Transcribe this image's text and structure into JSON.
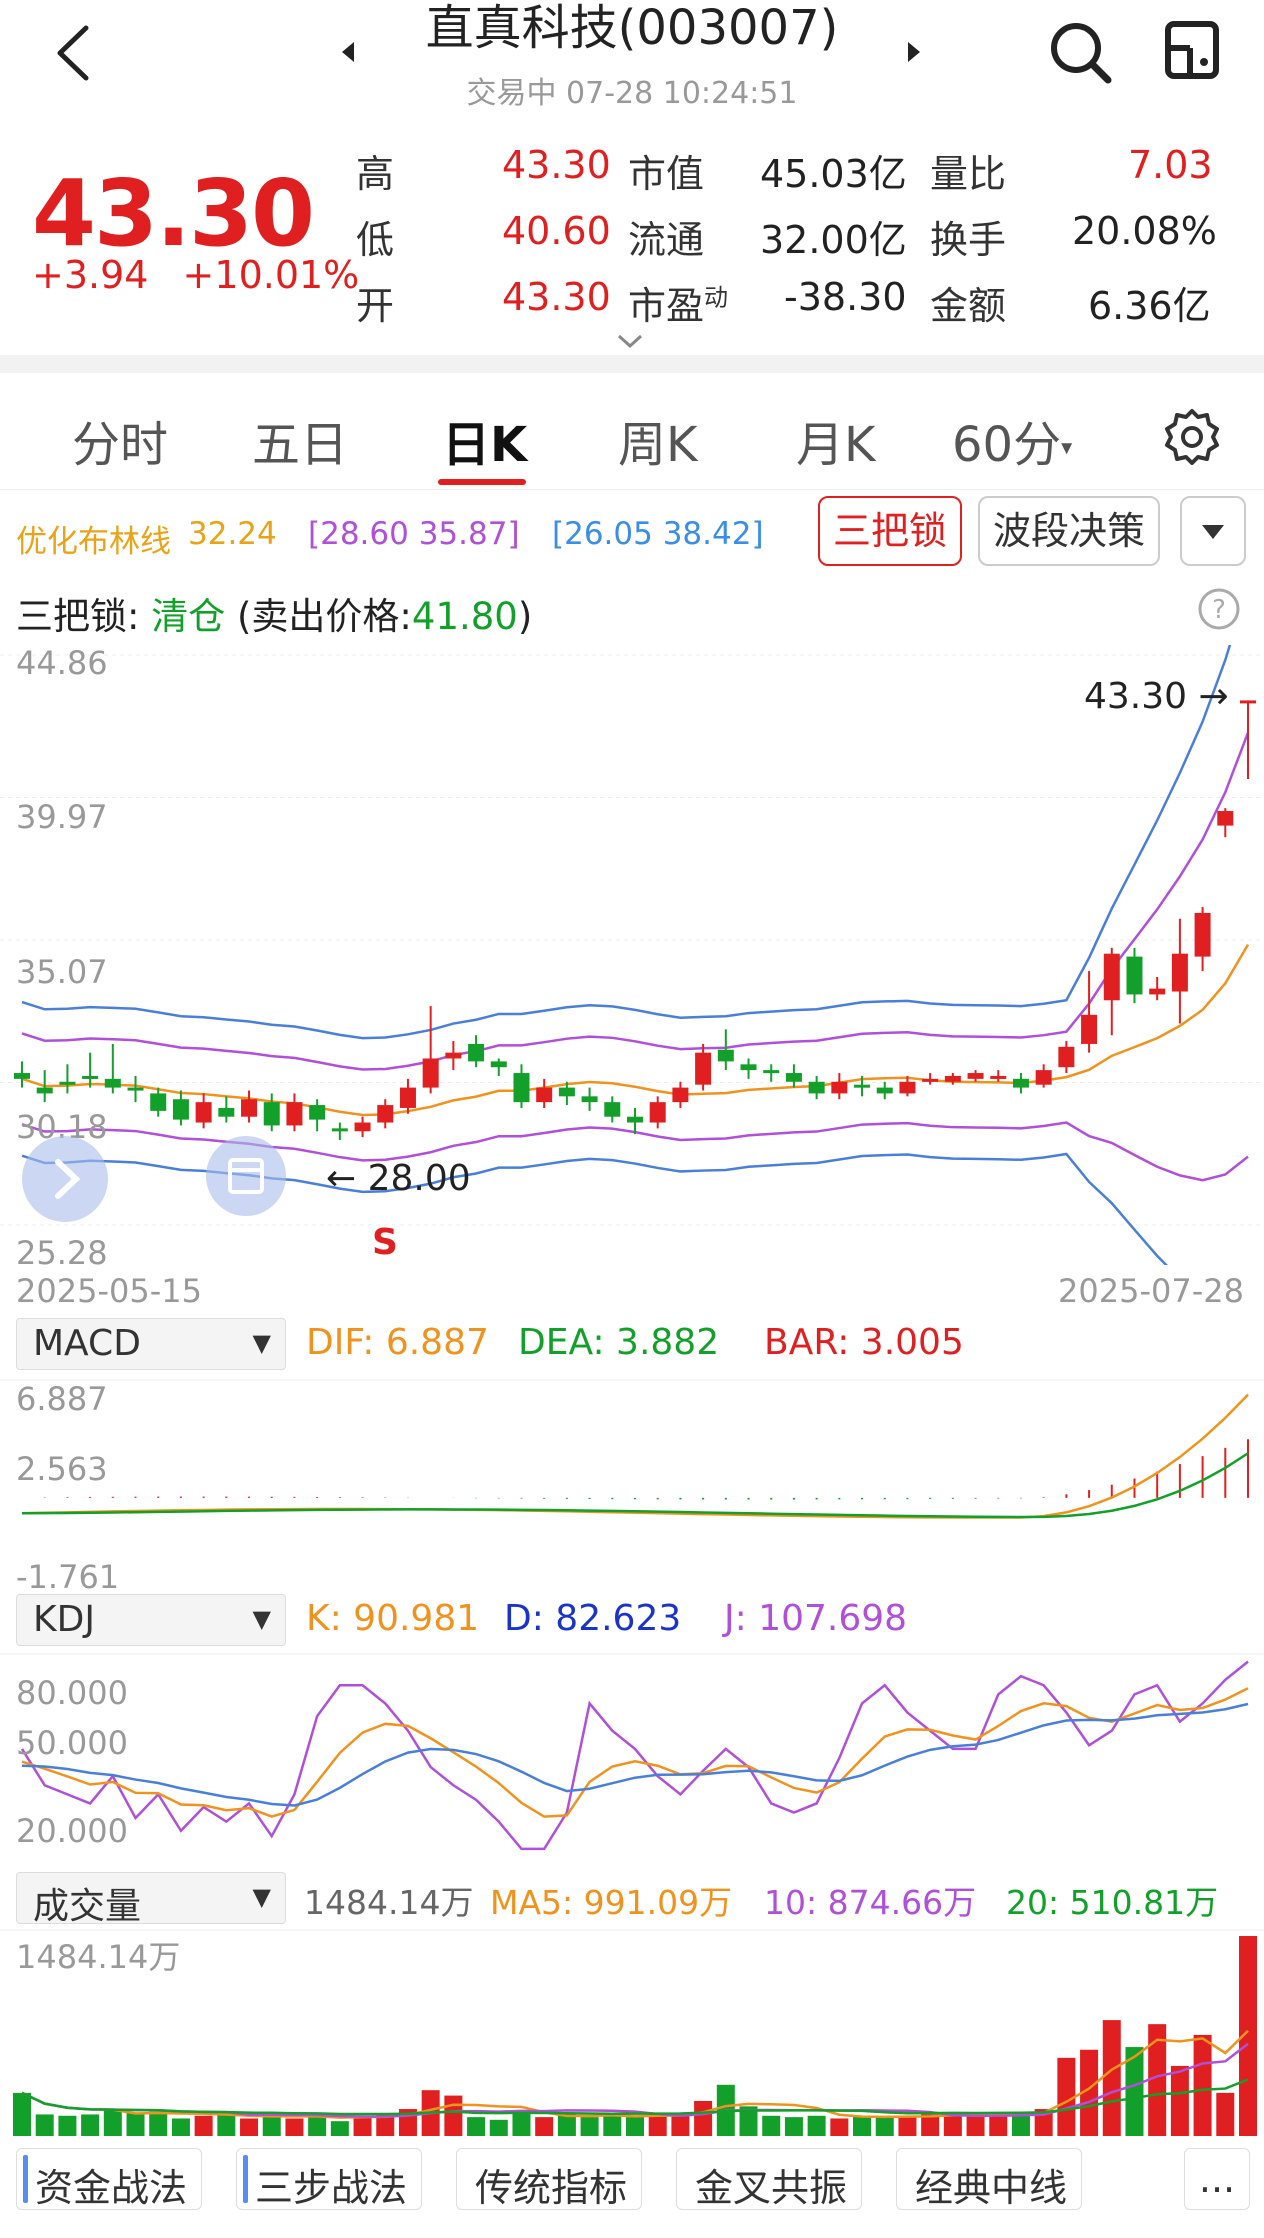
{
  "header": {
    "title": "直真科技(003007)",
    "status": "交易中 07-28 10:24:51",
    "back_icon": "back-icon",
    "prev_icon": "triangle-left-icon",
    "next_icon": "triangle-right-icon"
  },
  "quote": {
    "price": "43.30",
    "change": "+3.94",
    "change_pct": "+10.01%",
    "rows": [
      {
        "l1": "高",
        "v1": "43.30",
        "l2": "市值",
        "v2": "45.03亿",
        "l3": "量比",
        "v3": "7.03"
      },
      {
        "l1": "低",
        "v1": "40.60",
        "l2": "流通",
        "v2": "32.00亿",
        "l3": "换手",
        "v3": "20.08%"
      },
      {
        "l1": "开",
        "v1": "43.30",
        "l2": "市盈",
        "l2sup": "动",
        "v2": "-38.30",
        "l3": "金额",
        "v3": "6.36亿"
      }
    ]
  },
  "tabs": [
    {
      "label": "分时"
    },
    {
      "label": "五日"
    },
    {
      "label": "日K",
      "active": true
    },
    {
      "label": "周K"
    },
    {
      "label": "月K"
    },
    {
      "label": "60分"
    }
  ],
  "boll": {
    "name": "优化布林线",
    "mid": "32.24",
    "band1": "[28.60  35.87]",
    "band2": "[26.05  38.42]",
    "btn_sanbasuo": "三把锁",
    "btn_boduan": "波段决策"
  },
  "lock_status": {
    "label": "三把锁: ",
    "state": "清仓",
    "detail_open": " (卖出价格:",
    "price": "41.80",
    "detail_close": ")"
  },
  "kline_axis": {
    "y_labels": [
      "44.86",
      "39.97",
      "35.07",
      "30.18",
      "25.28"
    ],
    "x_start": "2025-05-15",
    "x_end": "2025-07-28",
    "last_price_tag": "43.30 →",
    "low_price_tag": "← 28.00",
    "s_marker": "S"
  },
  "macd": {
    "selector": "MACD",
    "dif": "DIF: 6.887",
    "dea": "DEA: 3.882",
    "bar": "BAR: 3.005",
    "y_labels": [
      "6.887",
      "2.563",
      "-1.761"
    ]
  },
  "kdj": {
    "selector": "KDJ",
    "k": "K: 90.981",
    "d": "D: 82.623",
    "j": "J: 107.698",
    "y_labels": [
      "80.000",
      "50.000",
      "20.000"
    ]
  },
  "volume": {
    "selector": "成交量",
    "total": "1484.14万",
    "ma5": "MA5: 991.09万",
    "ma10": "10: 874.66万",
    "ma20": "20: 510.81万",
    "y_label": "1484.14万"
  },
  "bottom_tabs": [
    "资金战法",
    "三步战法",
    "传统指标",
    "金叉共振",
    "经典中线",
    "..."
  ],
  "colors": {
    "up": "#e02020",
    "down": "#13a02a",
    "ma_orange": "#f0921e",
    "ma_purple": "#b04fd8",
    "ma_blue": "#4a7fd8"
  },
  "chart_data": {
    "type": "candlestick",
    "x_start": "2025-05-15",
    "x_end": "2025-07-28",
    "ylim": [
      25.28,
      44.86
    ],
    "candles": [
      [
        30.5,
        30.3,
        30.9,
        30.0
      ],
      [
        30.0,
        29.8,
        30.6,
        29.5
      ],
      [
        30.2,
        30.1,
        30.8,
        29.8
      ],
      [
        30.4,
        30.3,
        31.2,
        30.0
      ],
      [
        30.3,
        30.0,
        31.5,
        29.8
      ],
      [
        30.0,
        29.9,
        30.4,
        29.5
      ],
      [
        29.8,
        29.2,
        30.0,
        29.0
      ],
      [
        29.6,
        28.9,
        29.9,
        28.7
      ],
      [
        28.8,
        29.5,
        29.8,
        28.6
      ],
      [
        29.3,
        29.0,
        29.7,
        28.8
      ],
      [
        29.0,
        29.6,
        29.9,
        28.8
      ],
      [
        29.5,
        28.7,
        29.8,
        28.5
      ],
      [
        28.7,
        29.5,
        29.8,
        28.5
      ],
      [
        29.4,
        28.9,
        29.6,
        28.5
      ],
      [
        28.6,
        28.5,
        28.8,
        28.2
      ],
      [
        28.5,
        28.8,
        29.0,
        28.3
      ],
      [
        28.8,
        29.4,
        29.6,
        28.6
      ],
      [
        29.3,
        30.0,
        30.3,
        29.1
      ],
      [
        30.0,
        31.0,
        32.8,
        29.8
      ],
      [
        31.0,
        31.2,
        31.6,
        30.6
      ],
      [
        31.5,
        30.9,
        31.8,
        30.7
      ],
      [
        30.9,
        30.7,
        31.0,
        30.4
      ],
      [
        30.5,
        29.5,
        30.8,
        29.3
      ],
      [
        29.5,
        30.0,
        30.3,
        29.3
      ],
      [
        30.0,
        29.7,
        30.2,
        29.4
      ],
      [
        29.7,
        29.5,
        30.0,
        29.2
      ],
      [
        29.5,
        29.0,
        29.7,
        28.8
      ],
      [
        29.0,
        28.8,
        29.3,
        28.4
      ],
      [
        28.8,
        29.5,
        29.7,
        28.6
      ],
      [
        29.5,
        30.0,
        30.2,
        29.3
      ],
      [
        30.1,
        31.2,
        31.5,
        29.9
      ],
      [
        31.3,
        30.9,
        32.0,
        30.6
      ],
      [
        30.8,
        30.6,
        31.0,
        30.3
      ],
      [
        30.6,
        30.5,
        30.8,
        30.2
      ],
      [
        30.5,
        30.2,
        30.8,
        30.0
      ],
      [
        30.2,
        29.8,
        30.4,
        29.6
      ],
      [
        29.8,
        30.2,
        30.5,
        29.6
      ],
      [
        30.1,
        30.0,
        30.4,
        29.7
      ],
      [
        30.0,
        29.8,
        30.2,
        29.6
      ],
      [
        29.8,
        30.2,
        30.4,
        29.7
      ],
      [
        30.3,
        30.3,
        30.5,
        30.1
      ],
      [
        30.2,
        30.4,
        30.5,
        30.1
      ],
      [
        30.3,
        30.5,
        30.6,
        30.2
      ],
      [
        30.4,
        30.4,
        30.6,
        30.2
      ],
      [
        30.3,
        30.0,
        30.5,
        29.8
      ],
      [
        30.1,
        30.6,
        30.8,
        30.0
      ],
      [
        30.7,
        31.4,
        31.6,
        30.5
      ],
      [
        31.5,
        32.5,
        34.0,
        31.2
      ],
      [
        33.0,
        34.6,
        34.8,
        31.8
      ],
      [
        34.5,
        33.2,
        34.8,
        32.9
      ],
      [
        33.2,
        33.4,
        33.8,
        33.0
      ],
      [
        33.3,
        34.6,
        35.8,
        32.2
      ],
      [
        34.5,
        36.0,
        36.2,
        34.0
      ],
      [
        39.0,
        39.5,
        39.6,
        38.6
      ],
      [
        43.3,
        43.3,
        43.3,
        40.6
      ]
    ]
  }
}
